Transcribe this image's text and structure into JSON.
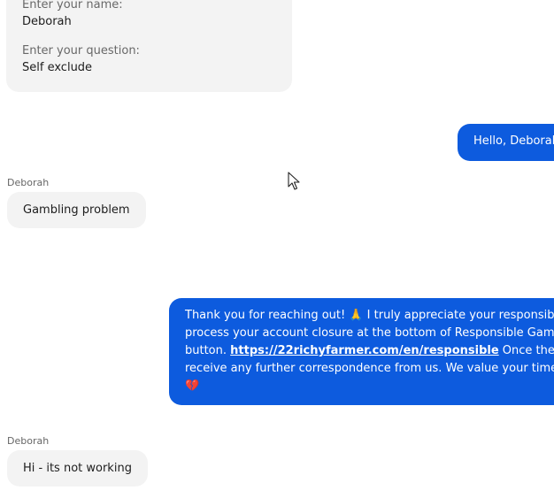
{
  "form": {
    "name_label": "Enter your name:",
    "name_value": "Deborah",
    "question_label": "Enter your question:",
    "question_value": "Self exclude"
  },
  "messages": [
    {
      "from": "agent",
      "text": "Hello, Deborah!"
    },
    {
      "from": "user",
      "sender": "Deborah",
      "text": "Gambling problem"
    },
    {
      "from": "agent",
      "lines": [
        "Thank you for reaching out! 🙏 I truly appreciate your responsibility in",
        "process your account closure at the bottom of Responsible Gaming, us",
        "Once the process",
        "receive any further correspondence from us. We value your time and a",
        "💔"
      ],
      "line3_prefix": "button. ",
      "link": "https://22richyfarmer.com/en/responsible"
    },
    {
      "from": "user",
      "sender": "Deborah",
      "text": "Hi - its not working"
    }
  ],
  "colors": {
    "agent_bubble": "#0d5bde",
    "user_bubble": "#f3f3f3"
  },
  "icons": {
    "cursor": "mouse-pointer-icon"
  }
}
